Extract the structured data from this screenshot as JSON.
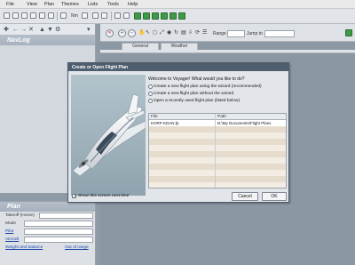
{
  "menu": [
    "File",
    "View",
    "Plan",
    "Themes",
    "Lists",
    "Tools",
    "Help"
  ],
  "toolbar": {
    "nm_label": "Nm"
  },
  "navlog": {
    "title": "NavLog"
  },
  "map": {
    "range_label": "Range",
    "jump_label": "Jump to",
    "tabs": [
      "General",
      "Weather"
    ]
  },
  "plan": {
    "title": "Plan",
    "rows": [
      {
        "label": "Takeoff (Home)"
      },
      {
        "label": "Mode"
      },
      {
        "label": "Pilot"
      },
      {
        "label": "Aircraft"
      }
    ],
    "links": [
      "Weight and balance",
      "Out of range"
    ]
  },
  "dialog": {
    "title": "Create or Open Flight Plan",
    "question": "Welcome to Voyager!  What would you like to do?",
    "options": [
      "Create a new flight plan using the wizard (recommended)",
      "Create a new flight plan without the wizard",
      "Open a recently used flight plan (listed below)"
    ],
    "table": {
      "headers": [
        "File",
        "Path"
      ],
      "rows": [
        {
          "file": "KORF-KDAN.fp",
          "path": "D:\\My Documents\\Flight Plans"
        }
      ]
    },
    "show_next_time": "Show this screen next time",
    "cancel": "Cancel",
    "ok": "OK"
  }
}
